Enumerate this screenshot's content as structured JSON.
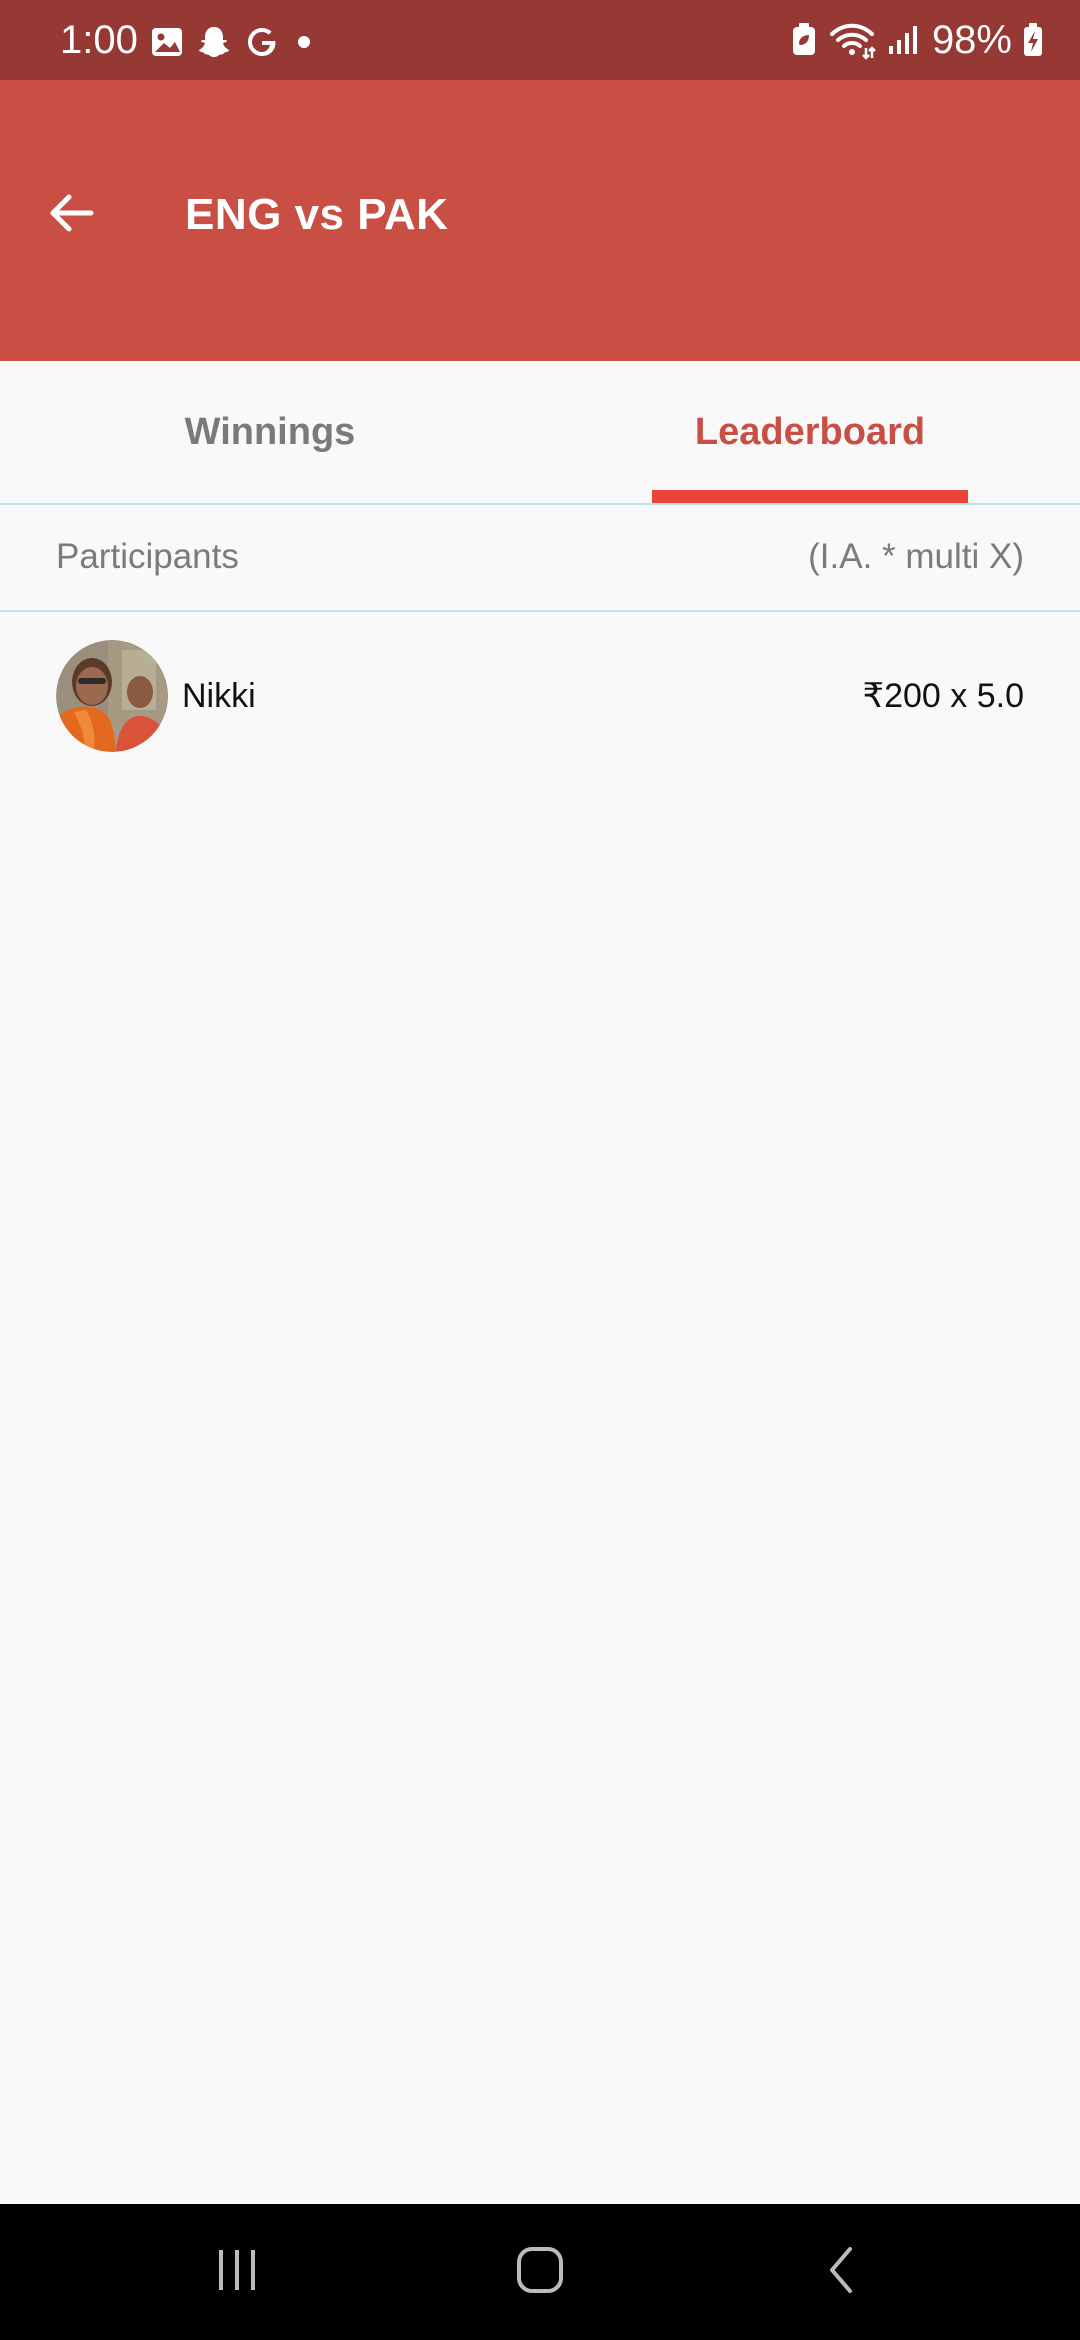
{
  "status_bar": {
    "time": "1:00",
    "battery": "98%",
    "icons": [
      "gallery-icon",
      "snapchat-icon",
      "google-icon",
      "dot-icon",
      "battery-saver-icon",
      "wifi-icon",
      "signal-icon",
      "battery-icon"
    ]
  },
  "app_bar": {
    "title": "ENG vs PAK",
    "back_icon": "arrow-left-icon"
  },
  "tabs": [
    {
      "label": "Winnings",
      "selected": false
    },
    {
      "label": "Leaderboard",
      "selected": true
    }
  ],
  "leaderboard": {
    "header_left": "Participants",
    "header_right": "(I.A. * multi X)",
    "participants": [
      {
        "name": "Nikki",
        "amount": "₹200 x 5.0"
      }
    ]
  },
  "nav_bar": {
    "icons": [
      "recents-icon",
      "home-icon",
      "back-icon"
    ]
  },
  "colors": {
    "status_bar": "#963833",
    "app_bar": "#c94f45",
    "tab_indicator": "#ea4337",
    "selected_tab": "#c94f45",
    "unselected_tab": "#7a7a7a",
    "divider": "#bfe3ea"
  }
}
